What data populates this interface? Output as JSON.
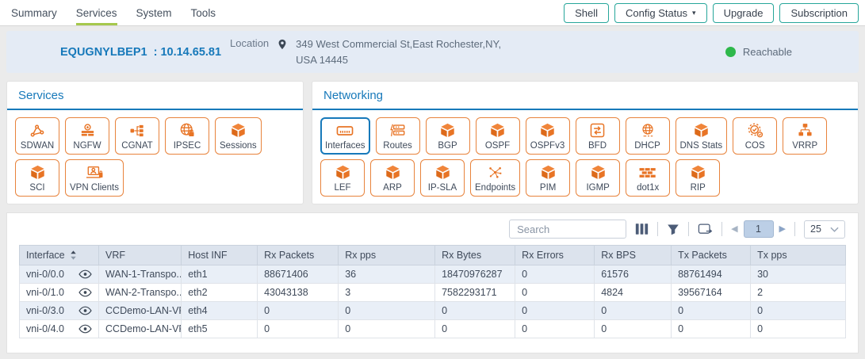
{
  "nav": {
    "tabs": [
      {
        "label": "Summary",
        "active": false
      },
      {
        "label": "Services",
        "active": true
      },
      {
        "label": "System",
        "active": false
      },
      {
        "label": "Tools",
        "active": false
      }
    ],
    "buttons": [
      {
        "label": "Shell",
        "has_caret": false
      },
      {
        "label": "Config Status",
        "has_caret": true
      },
      {
        "label": "Upgrade",
        "has_caret": false
      },
      {
        "label": "Subscription",
        "has_caret": false
      }
    ]
  },
  "device_bar": {
    "name": "EQUGNYLBEP1",
    "ip_label": ": 10.14.65.81",
    "location_label": "Location",
    "address_line1": "349 West Commercial St,East Rochester,NY,",
    "address_line2": "USA 14445",
    "status": "Reachable"
  },
  "panels": [
    {
      "title": "Services",
      "rows": [
        [
          {
            "label": "SDWAN",
            "icon": "share-nodes",
            "selected": false
          },
          {
            "label": "NGFW",
            "icon": "firewall",
            "selected": false
          },
          {
            "label": "CGNAT",
            "icon": "splitter",
            "selected": false
          },
          {
            "label": "IPSEC",
            "icon": "globe-lock",
            "selected": false
          },
          {
            "label": "Sessions",
            "icon": "cube",
            "selected": false
          }
        ],
        [
          {
            "label": "SCI",
            "icon": "cube",
            "selected": false
          },
          {
            "label": "VPN Clients",
            "icon": "laptop-user",
            "selected": false
          }
        ]
      ]
    },
    {
      "title": "Networking",
      "rows": [
        [
          {
            "label": "Interfaces",
            "icon": "ethernet-port",
            "selected": true
          },
          {
            "label": "Routes",
            "icon": "router-stack",
            "selected": false
          },
          {
            "label": "BGP",
            "icon": "cube",
            "selected": false
          },
          {
            "label": "OSPF",
            "icon": "cube",
            "selected": false
          },
          {
            "label": "OSPFv3",
            "icon": "cube",
            "selected": false
          },
          {
            "label": "BFD",
            "icon": "transfer-arrows",
            "selected": false
          },
          {
            "label": "DHCP",
            "icon": "globe",
            "selected": false
          },
          {
            "label": "DNS Stats",
            "icon": "cube",
            "selected": false
          },
          {
            "label": "COS",
            "icon": "gear-check",
            "selected": false
          },
          {
            "label": "VRRP",
            "icon": "node-hierarchy",
            "selected": false
          }
        ],
        [
          {
            "label": "LEF",
            "icon": "cube",
            "selected": false
          },
          {
            "label": "ARP",
            "icon": "cube",
            "selected": false
          },
          {
            "label": "IP-SLA",
            "icon": "cube",
            "selected": false
          },
          {
            "label": "Endpoints",
            "icon": "scatter-nodes",
            "selected": false
          },
          {
            "label": "PIM",
            "icon": "cube",
            "selected": false
          },
          {
            "label": "IGMP",
            "icon": "cube",
            "selected": false
          },
          {
            "label": "dot1x",
            "icon": "brick-wall",
            "selected": false
          },
          {
            "label": "RIP",
            "icon": "cube",
            "selected": false
          }
        ]
      ]
    }
  ],
  "table": {
    "toolbar": {
      "search_placeholder": "Search",
      "page": "1",
      "page_size": "25"
    },
    "columns": [
      "Interface",
      "VRF",
      "Host INF",
      "Rx Packets",
      "Rx pps",
      "Rx Bytes",
      "Rx Errors",
      "Rx BPS",
      "Tx Packets",
      "Tx pps"
    ],
    "rows": [
      [
        "vni-0/0.0",
        "WAN-1-Transpo...",
        "eth1",
        "88671406",
        "36",
        "18470976287",
        "0",
        "61576",
        "88761494",
        "30"
      ],
      [
        "vni-0/1.0",
        "WAN-2-Transpo...",
        "eth2",
        "43043138",
        "3",
        "7582293171",
        "0",
        "4824",
        "39567164",
        "2"
      ],
      [
        "vni-0/3.0",
        "CCDemo-LAN-VR",
        "eth4",
        "0",
        "0",
        "0",
        "0",
        "0",
        "0",
        "0"
      ],
      [
        "vni-0/4.0",
        "CCDemo-LAN-VR",
        "eth5",
        "0",
        "0",
        "0",
        "0",
        "0",
        "0",
        "0"
      ]
    ]
  },
  "colors": {
    "accent_blue": "#1779ba",
    "accent_orange": "#e87425",
    "button_teal": "#26a69a",
    "active_tab_green": "#a6c84c",
    "status_green": "#2eb84b"
  }
}
